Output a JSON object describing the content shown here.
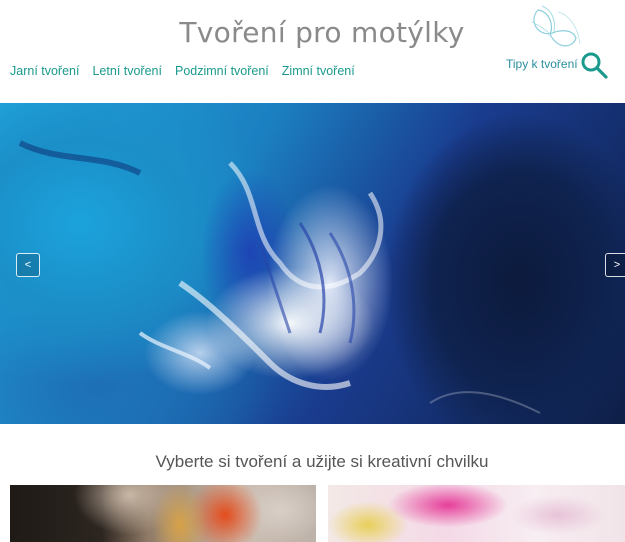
{
  "header": {
    "site_title": "Tvoření pro motýlky",
    "tips_link": "Tipy k tvoření",
    "brand_color": "#1a9a8c"
  },
  "nav": {
    "items": [
      {
        "label": "Jarní tvoření"
      },
      {
        "label": "Letní tvoření"
      },
      {
        "label": "Podzimní tvoření"
      },
      {
        "label": "Zimní tvoření"
      }
    ]
  },
  "slider": {
    "prev_label": "<",
    "next_label": ">",
    "image": "abstract blue and white fluid paint artwork"
  },
  "main": {
    "tagline": "Vyberte si tvoření a užijte si kreativní chvilku"
  },
  "icons": {
    "logo": "butterfly-icon",
    "search": "search-icon"
  }
}
